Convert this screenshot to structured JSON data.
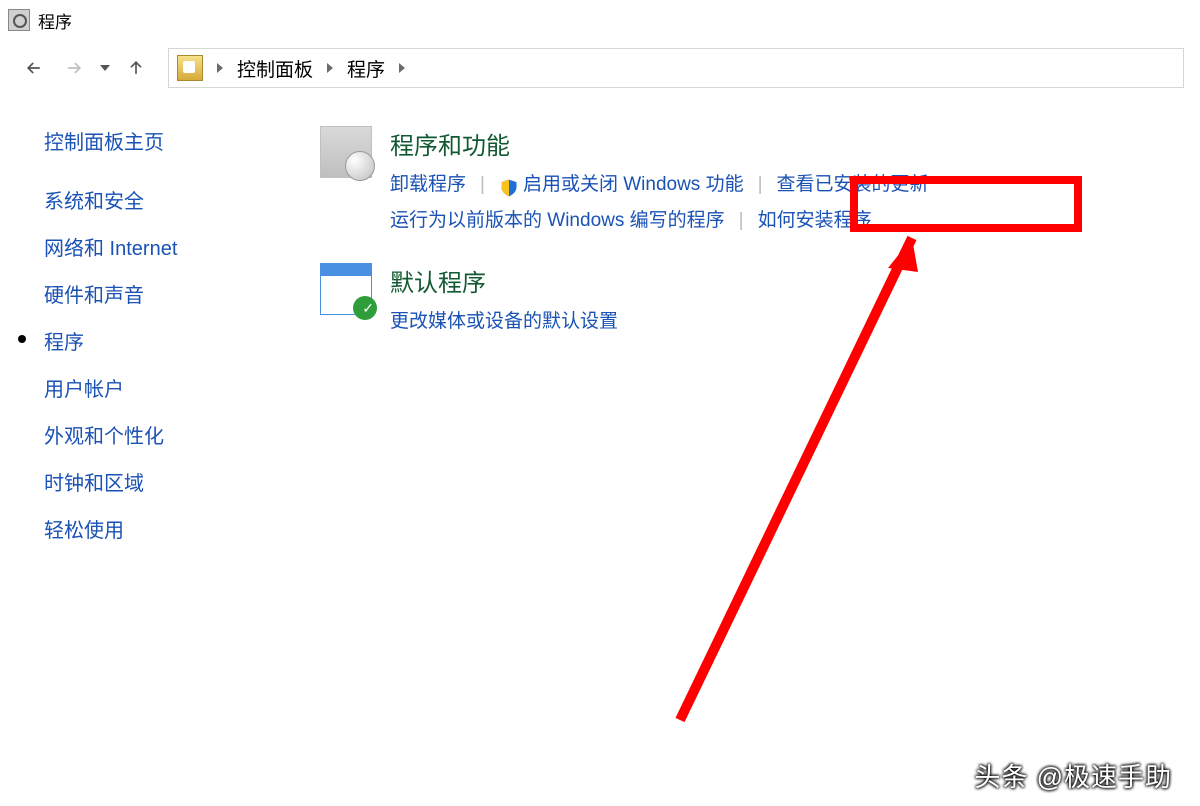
{
  "window": {
    "title": "程序"
  },
  "nav": {
    "breadcrumbs": [
      "控制面板",
      "程序"
    ]
  },
  "sidebar": {
    "home": "控制面板主页",
    "items": [
      {
        "label": "系统和安全"
      },
      {
        "label": "网络和 Internet"
      },
      {
        "label": "硬件和声音"
      },
      {
        "label": "程序",
        "active": true
      },
      {
        "label": "用户帐户"
      },
      {
        "label": "外观和个性化"
      },
      {
        "label": "时钟和区域"
      },
      {
        "label": "轻松使用"
      }
    ]
  },
  "sections": {
    "programs": {
      "title": "程序和功能",
      "links": {
        "uninstall": "卸载程序",
        "windows_features": "启用或关闭 Windows 功能",
        "view_updates": "查看已安装的更新",
        "compat": "运行为以前版本的 Windows 编写的程序",
        "howto": "如何安装程序"
      }
    },
    "defaults": {
      "title": "默认程序",
      "links": {
        "change_defaults": "更改媒体或设备的默认设置"
      }
    }
  },
  "watermark": "头条 @极速手助"
}
